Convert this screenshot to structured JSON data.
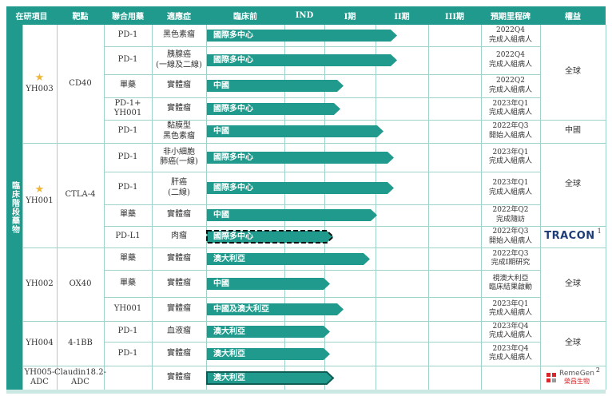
{
  "headers": {
    "candidate": "在研項目",
    "target": "靶點",
    "combo": "聯合用藥",
    "indication": "適應症",
    "preclinical": "臨床前",
    "ind": "IND",
    "phase1": "I期",
    "phase2": "II期",
    "phase3": "III期",
    "milestone": "預期里程碑",
    "rights": "權益"
  },
  "side_label": "臨床階段藥物",
  "candidates": [
    {
      "name": "YH003",
      "target": "CD40",
      "starred": true
    },
    {
      "name": "YH001",
      "target": "CTLA-4",
      "starred": true
    },
    {
      "name": "YH002",
      "target": "OX40",
      "starred": false
    },
    {
      "name": "YH004",
      "target": "4-1BB",
      "starred": false
    },
    {
      "name": "YH005-\nADC",
      "target": "Claudin18.2-\nADC",
      "starred": false
    }
  ],
  "rows": [
    {
      "combo": "PD-1",
      "indication": "黑色素瘤",
      "bar_label": "國際多中心",
      "progress": 0.57,
      "dashed": false,
      "milestone": "2022Q4\n完成入組病人"
    },
    {
      "combo": "PD-1",
      "indication": "胰腺癌\n(一線及二線)",
      "bar_label": "國際多中心",
      "progress": 0.57,
      "dashed": false,
      "milestone": "2022Q4\n完成入組病人"
    },
    {
      "combo": "單藥",
      "indication": "實體瘤",
      "bar_label": "中國",
      "progress": 0.41,
      "dashed": false,
      "milestone": "2022Q2\n完成入組病人"
    },
    {
      "combo": "PD-1+\nYH001",
      "indication": "實體瘤",
      "bar_label": "國際多中心",
      "progress": 0.4,
      "dashed": false,
      "milestone": "2023年Q1\n完成入組病人"
    },
    {
      "combo": "PD-1",
      "indication": "黏膜型\n黑色素瘤",
      "bar_label": "中國",
      "progress": 0.53,
      "dashed": false,
      "milestone": "2022年Q3\n開始入組病人"
    },
    {
      "combo": "PD-1",
      "indication": "非小細胞\n肺癌(一線)",
      "bar_label": "國際多中心",
      "progress": 0.56,
      "dashed": false,
      "milestone": "2023年Q1\n完成入組病人"
    },
    {
      "combo": "PD-1",
      "indication": "肝癌\n(二線)",
      "bar_label": "國際多中心",
      "progress": 0.56,
      "dashed": false,
      "milestone": "2023年Q1\n完成入組病人"
    },
    {
      "combo": "單藥",
      "indication": "實體瘤",
      "bar_label": "中國",
      "progress": 0.51,
      "dashed": false,
      "milestone": "2022年Q2\n完成隨訪"
    },
    {
      "combo": "PD-L1",
      "indication": "肉瘤",
      "bar_label": "國際多中心",
      "progress": 0.38,
      "dashed": true,
      "milestone": "2022年Q3\n開始入組病人"
    },
    {
      "combo": "單藥",
      "indication": "實體瘤",
      "bar_label": "澳大利亞",
      "progress": 0.49,
      "dashed": false,
      "milestone": "2022年Q3\n完成I期研究"
    },
    {
      "combo": "單藥",
      "indication": "實體瘤",
      "bar_label": "中國",
      "progress": 0.37,
      "dashed": false,
      "milestone": "視澳大利亞\n臨床結果啟動"
    },
    {
      "combo": "YH001",
      "indication": "實體瘤",
      "bar_label": "中國及澳大利亞",
      "progress": 0.41,
      "dashed": false,
      "milestone": "2023年Q1\n完成入組病人"
    },
    {
      "combo": "PD-1",
      "indication": "血液瘤",
      "bar_label": "澳大利亞",
      "progress": 0.37,
      "dashed": false,
      "milestone": "2023年Q4\n完成入組病人"
    },
    {
      "combo": "PD-1",
      "indication": "實體瘤",
      "bar_label": "澳大利亞",
      "progress": 0.37,
      "dashed": false,
      "milestone": "2023年Q4\n完成入組病人"
    },
    {
      "combo": "",
      "indication": "實體瘤",
      "bar_label": "澳大利亞",
      "progress": 0.38,
      "dashed": false,
      "outline": true,
      "milestone": ""
    }
  ],
  "rights": [
    {
      "text": "全球"
    },
    {
      "text": "中國"
    },
    {
      "text": "全球"
    },
    {
      "text": "TRACON",
      "logo": true,
      "sup": "1"
    },
    {
      "text": "全球"
    },
    {
      "text": "全球"
    },
    {
      "text": "RemeGen",
      "sub": "榮昌生物",
      "logo": true,
      "sup": "2"
    }
  ],
  "colors": {
    "teal": "#1f9a8c",
    "dark_teal": "#0f5d54",
    "tracon_blue": "#1e3c78",
    "remegen_red": "#d8282b"
  },
  "icons": {
    "star": "star-icon"
  }
}
